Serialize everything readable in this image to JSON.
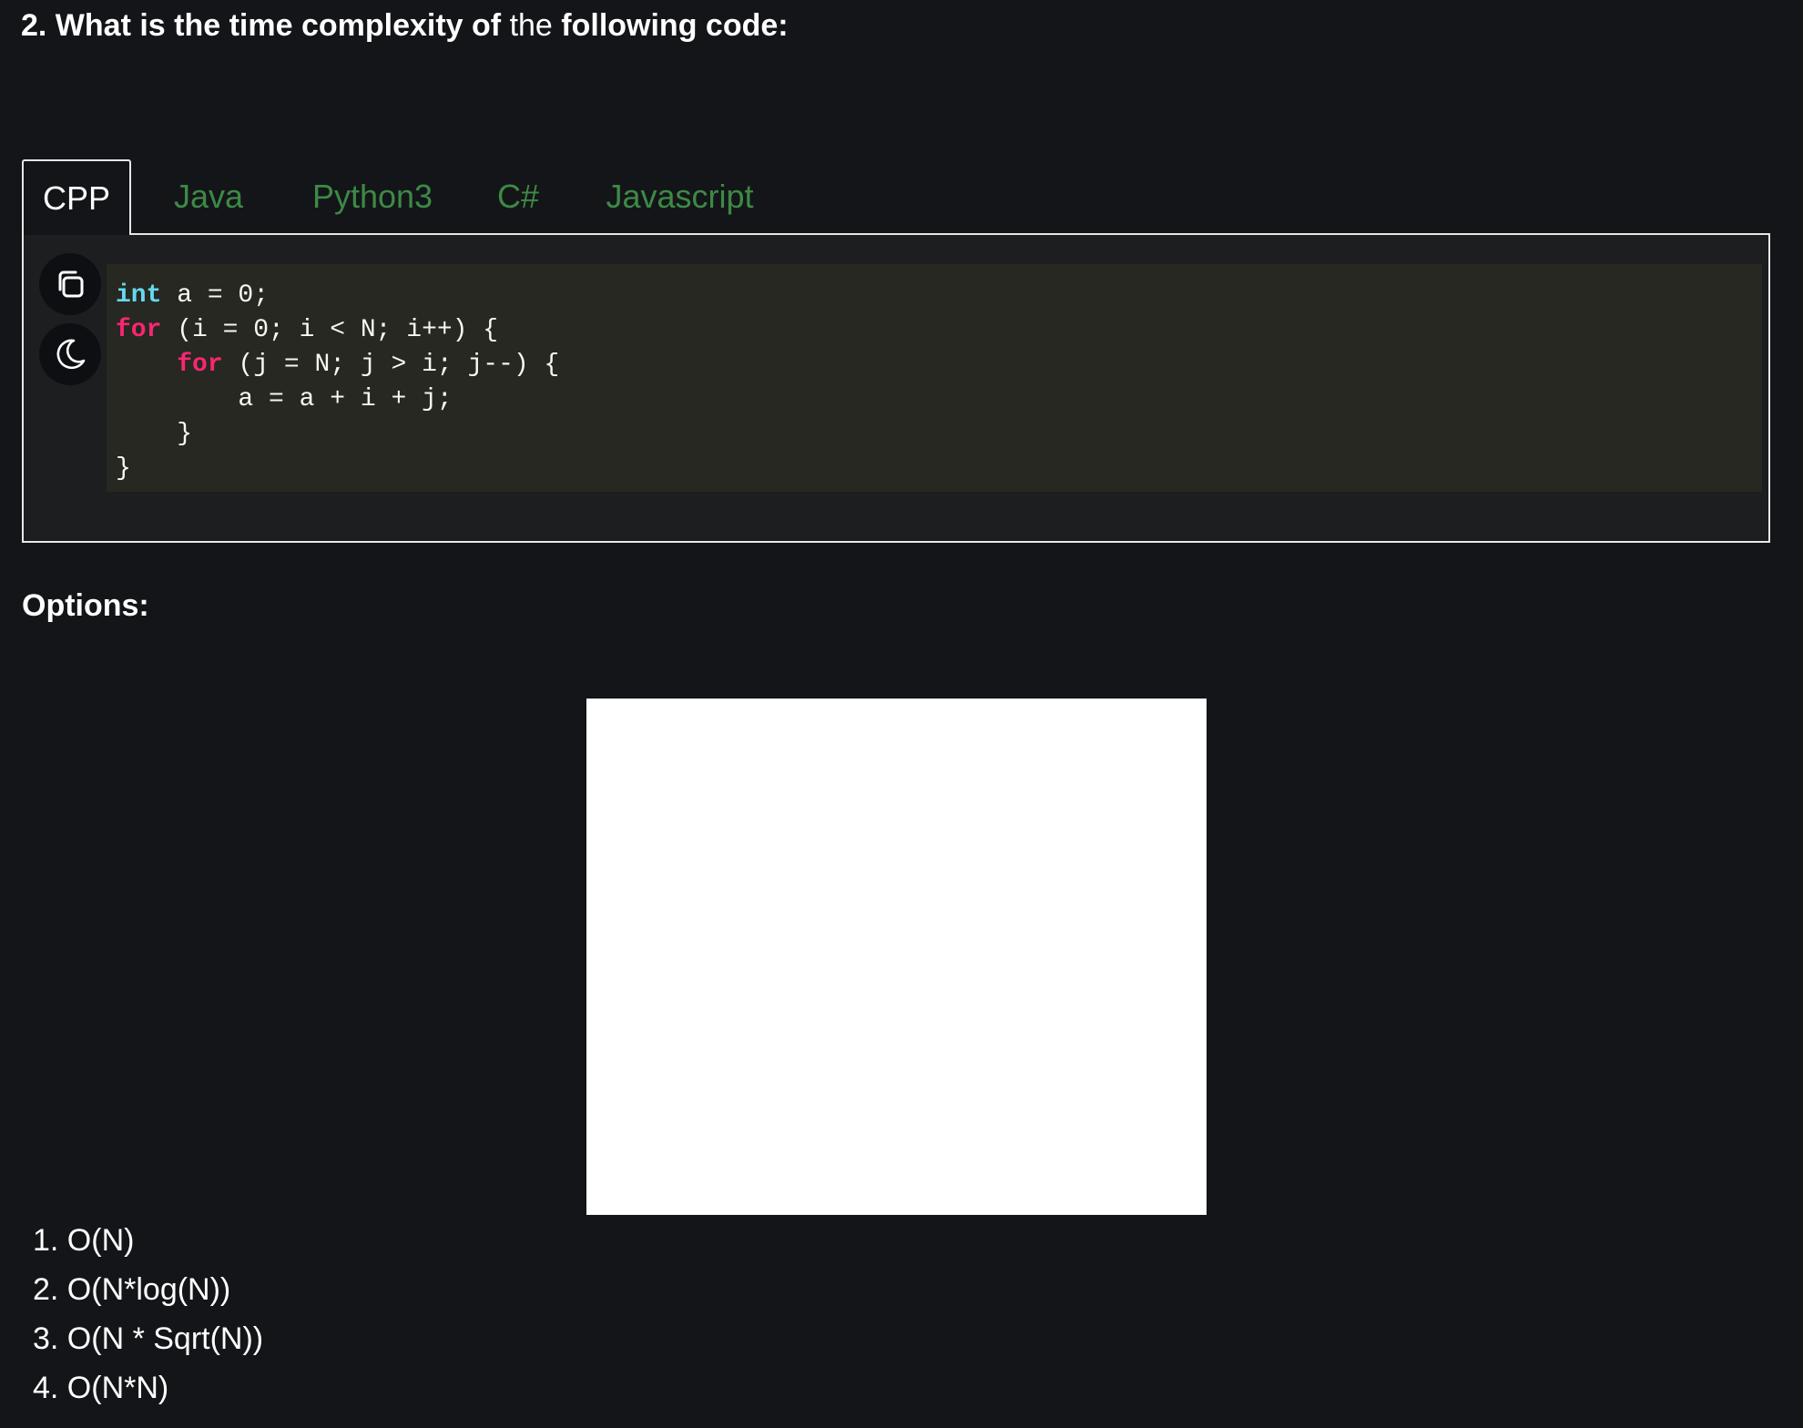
{
  "question": {
    "bold_start": "2. What is the time complexity of",
    "regular": "the",
    "bold_end": "following code:"
  },
  "tabs": [
    {
      "label": "CPP",
      "active": true
    },
    {
      "label": "Java",
      "active": false
    },
    {
      "label": "Python3",
      "active": false
    },
    {
      "label": "C#",
      "active": false
    },
    {
      "label": "Javascript",
      "active": false
    }
  ],
  "toolbar": {
    "copy_icon": "copy-icon",
    "theme_icon": "moon-icon"
  },
  "code": {
    "line1": {
      "kw": "int",
      "rest": " a = 0;"
    },
    "line2": {
      "kw": "for",
      "rest": " (i = 0; i < N; i++) {"
    },
    "line3": {
      "indent": "    ",
      "kw": "for",
      "rest": " (j = N; j > i; j--) {"
    },
    "line4": "        a = a + i + j;",
    "line5": "    }",
    "line6": "}"
  },
  "options_heading": "Options:",
  "options": [
    "1. O(N)",
    "2. O(N*log(N))",
    "3. O(N * Sqrt(N))",
    "4. O(N*N)"
  ],
  "colors": {
    "background": "#141519",
    "tab_inactive": "#3c8a45",
    "code_background": "#272822",
    "keyword_type": "#66d9ef",
    "keyword": "#f92672"
  }
}
